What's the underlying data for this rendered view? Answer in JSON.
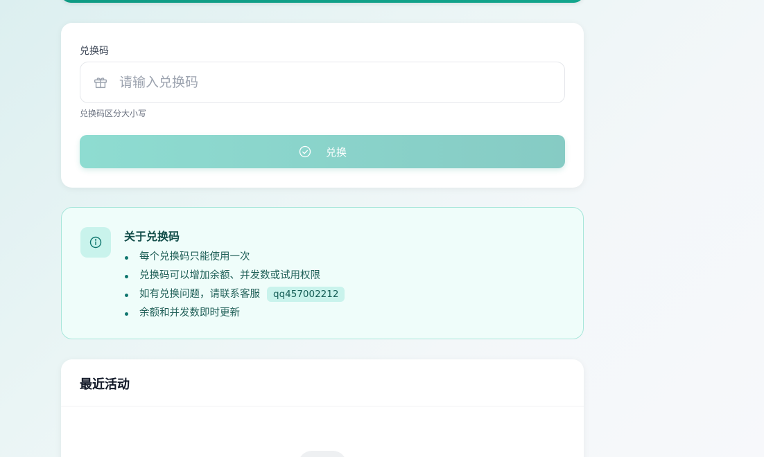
{
  "redeem": {
    "label": "兑换码",
    "placeholder": "请输入兑换码",
    "hint": "兑换码区分大小写",
    "button_label": "兑换"
  },
  "about": {
    "title": "关于兑换码",
    "items": [
      "每个兑换码只能使用一次",
      "兑换码可以增加余额、并发数或试用权限",
      "如有兑换问题，请联系客服",
      "余额和并发数即时更新"
    ],
    "contact": "qq457002212"
  },
  "activity": {
    "title": "最近活动"
  },
  "colors": {
    "accent": "#12a58c",
    "button": "#8edcd1",
    "info_bg": "#effdfa",
    "info_border": "#a7e6da"
  }
}
